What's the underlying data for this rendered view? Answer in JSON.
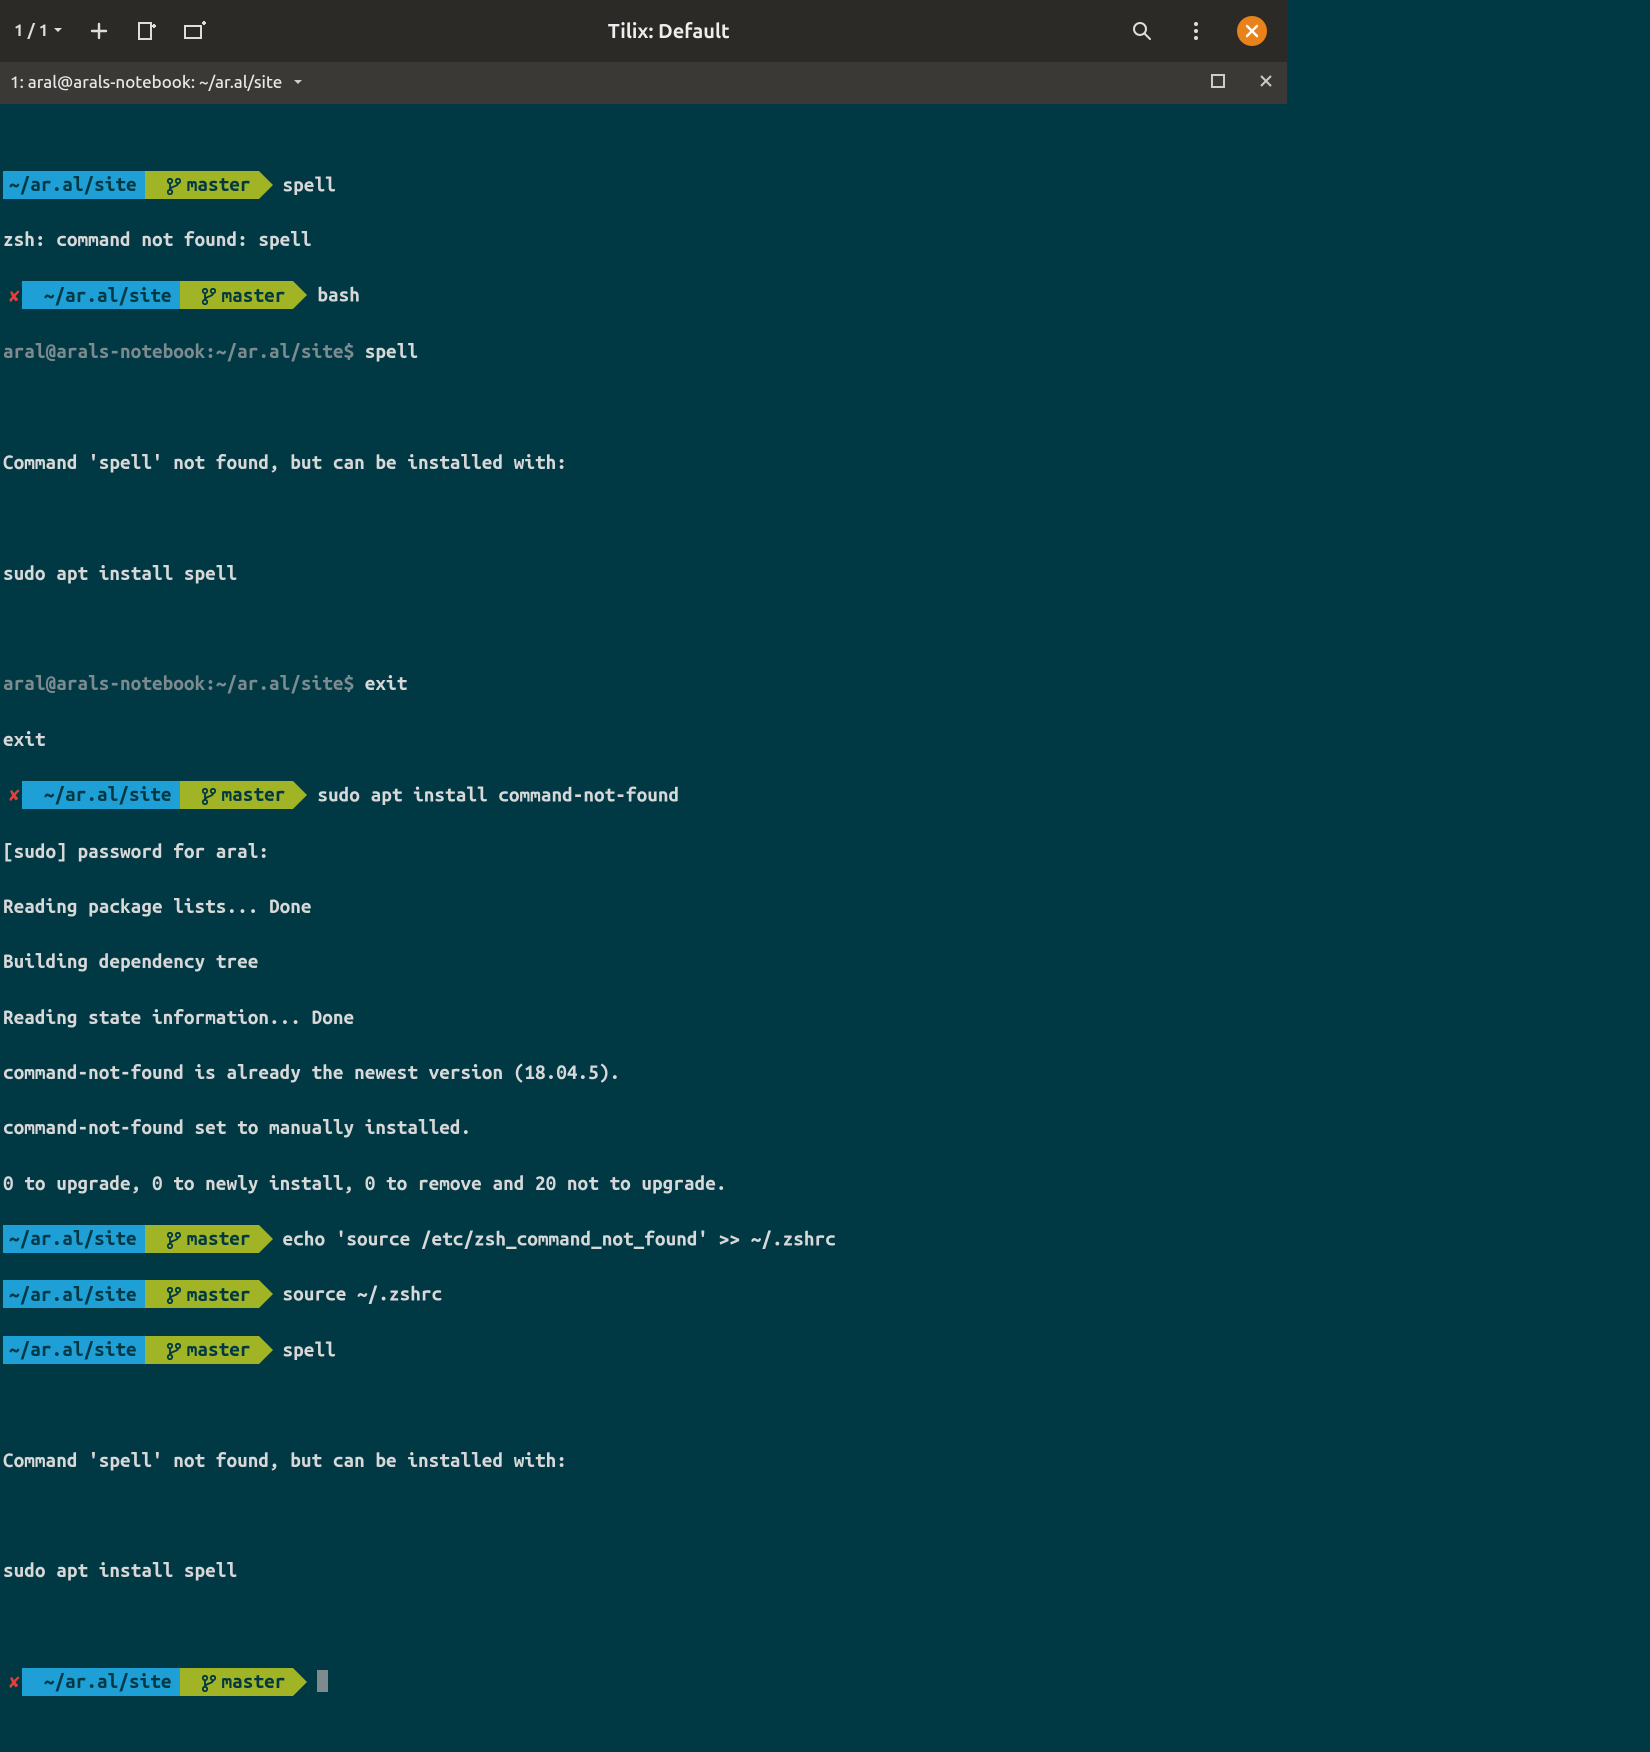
{
  "header": {
    "session": "1 / 1",
    "title": "Tilix: Default"
  },
  "tabbar": {
    "tab_title": "1: aral@arals-notebook: ~/ar.al/site"
  },
  "prompt": {
    "path": "~/ar.al/site",
    "branch": "master",
    "err_mark": "✘",
    "bash_user": "aral@arals-notebook",
    "bash_path": "~/ar.al/site",
    "bash_sep": ":",
    "bash_dollar": "$"
  },
  "commands": {
    "c1": "spell",
    "c2": "bash",
    "c3": "spell",
    "c4": "exit",
    "c5": "sudo apt install command-not-found",
    "c6": "echo 'source /etc/zsh_command_not_found' >> ~/.zshrc",
    "c7": "source ~/.zshrc",
    "c8": "spell"
  },
  "output": {
    "o1": "zsh: command not found: spell",
    "o3a": "Command 'spell' not found, but can be installed with:",
    "o3b": "sudo apt install spell",
    "o4": "exit",
    "o5a": "[sudo] password for aral: ",
    "o5b": "Reading package lists... Done",
    "o5c": "Building dependency tree       ",
    "o5d": "Reading state information... Done",
    "o5e": "command-not-found is already the newest version (18.04.5).",
    "o5f": "command-not-found set to manually installed.",
    "o5g": "0 to upgrade, 0 to newly install, 0 to remove and 20 not to upgrade.",
    "o8a": "Command 'spell' not found, but can be installed with:",
    "o8b": "sudo apt install spell"
  }
}
